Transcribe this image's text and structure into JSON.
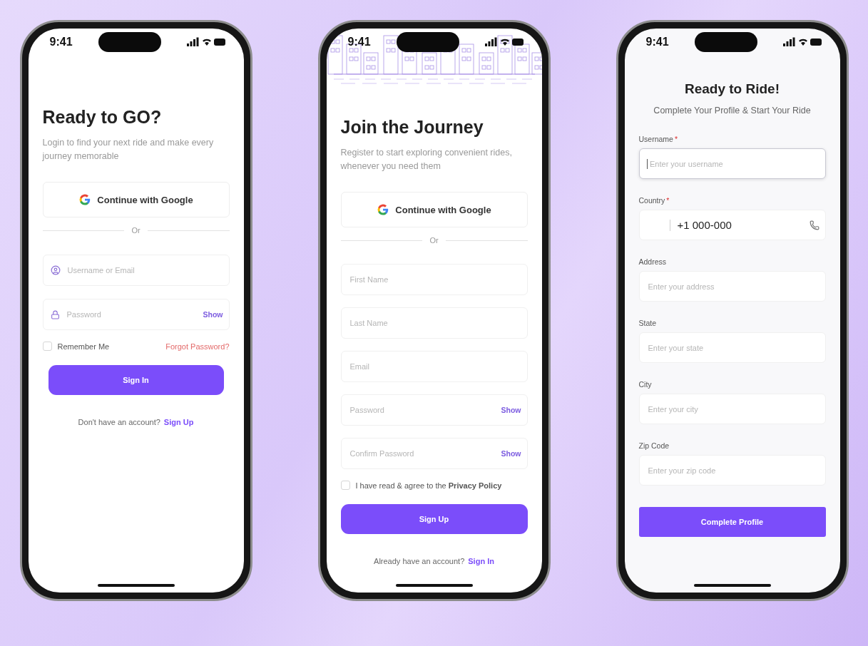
{
  "screens": [
    {
      "kind": "login",
      "status_time": "9:41",
      "title": "Ready to GO?",
      "subtitle": "Login to find your next ride and make every journey memorable",
      "google_button": "Continue with Google",
      "divider": "Or",
      "fields": [
        {
          "kind": "user",
          "placeholder": "Username or Email"
        },
        {
          "kind": "lock",
          "placeholder": "Password",
          "action": "Show"
        }
      ],
      "remember": {
        "label": "Remember Me",
        "checked": false
      },
      "forgot_link": "Forgot Password?",
      "primary_button": "Sign In",
      "footer": {
        "text": "Don't have an account?",
        "link": "Sign Up"
      }
    },
    {
      "kind": "register",
      "status_time": "9:41",
      "illustration": true,
      "title": "Join the Journey",
      "subtitle": "Register to start exploring convenient rides, whenever you need them",
      "google_button": "Continue with Google",
      "divider": "Or",
      "fields": [
        {
          "kind": "text",
          "placeholder": "First Name"
        },
        {
          "kind": "text",
          "placeholder": "Last Name"
        },
        {
          "kind": "text",
          "placeholder": "Email"
        },
        {
          "kind": "text",
          "placeholder": "Password",
          "action": "Show"
        },
        {
          "kind": "text",
          "placeholder": "Confirm Password",
          "action": "Show"
        }
      ],
      "agree": {
        "label": "I have read & agree to the **Privacy Policy**",
        "checked": false
      },
      "primary_button": "Sign Up",
      "footer": {
        "text": "Already have an account?",
        "link": "Sign In"
      }
    },
    {
      "kind": "profile",
      "status_time": "9:41",
      "title": "Ready to Ride!",
      "subtitle": "Complete Your Profile & Start Your Ride",
      "fields": [
        {
          "kind": "text",
          "label": "Username",
          "marker": "*",
          "placeholder": "Enter your username",
          "focused": true
        },
        {
          "kind": "phone",
          "label": "Country",
          "marker": "*",
          "value": "+1 000-000"
        },
        {
          "kind": "text",
          "label": "Address",
          "placeholder": "Enter your address"
        },
        {
          "kind": "text",
          "label": "State",
          "placeholder": "Enter your state"
        },
        {
          "kind": "text",
          "label": "City",
          "placeholder": "Enter your city"
        },
        {
          "kind": "text",
          "label": "Zip Code",
          "placeholder": "Enter your zip code"
        }
      ],
      "primary_button": "Complete Profile"
    }
  ]
}
